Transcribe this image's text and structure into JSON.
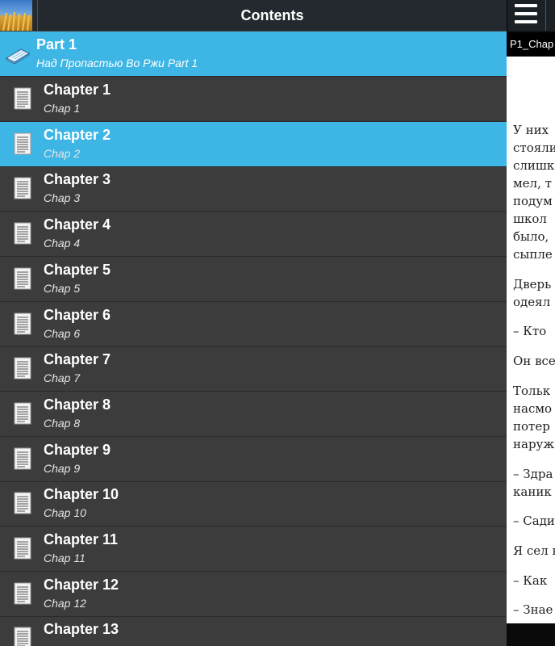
{
  "app": {
    "title": "Contents"
  },
  "reader": {
    "tab_label": "P1_Chap",
    "lines": [
      "У них",
      "стояли",
      "слишк",
      "мел, т",
      "подум",
      "школ",
      "было,",
      "сыпле",
      "Дверь",
      "одеял",
      "– Кто",
      "Он все",
      "Тольк",
      "насмо",
      "потер",
      "наруж",
      "– Здра",
      "каник",
      "– Сади",
      "Я сел к",
      "– Как",
      "– Знае"
    ]
  },
  "toc": {
    "part": {
      "title": "Part 1",
      "subtitle": "Над Пропастью Во Ржи Part 1"
    },
    "chapters": [
      {
        "title": "Chapter 1",
        "subtitle": "Chap 1"
      },
      {
        "title": "Chapter 2",
        "subtitle": "Chap 2"
      },
      {
        "title": "Chapter 3",
        "subtitle": "Chap 3"
      },
      {
        "title": "Chapter 4",
        "subtitle": "Chap 4"
      },
      {
        "title": "Chapter 5",
        "subtitle": "Chap 5"
      },
      {
        "title": "Chapter 6",
        "subtitle": "Chap 6"
      },
      {
        "title": "Chapter 7",
        "subtitle": "Chap 7"
      },
      {
        "title": "Chapter 8",
        "subtitle": "Chap 8"
      },
      {
        "title": "Chapter 9",
        "subtitle": "Chap 9"
      },
      {
        "title": "Chapter 10",
        "subtitle": "Chap 10"
      },
      {
        "title": "Chapter 11",
        "subtitle": "Chap 11"
      },
      {
        "title": "Chapter 12",
        "subtitle": "Chap 12"
      },
      {
        "title": "Chapter 13",
        "subtitle": ""
      }
    ],
    "selected_index": 1
  },
  "colors": {
    "accent": "#3db5e5",
    "list_bg": "#3c3c3c",
    "bar_bg": "#23292e"
  },
  "icons": {
    "logo": "wheat-field-logo",
    "menu": "menu-icon",
    "part": "book-icon",
    "chapter": "document-icon"
  }
}
